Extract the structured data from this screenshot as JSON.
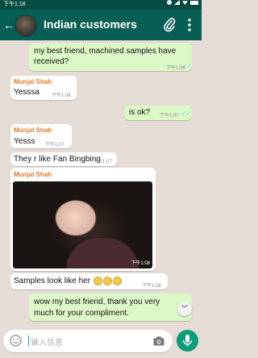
{
  "status_bar": {
    "time": "下午1:18"
  },
  "header": {
    "title": "Indian customers",
    "back_glyph": "←"
  },
  "messages": [
    {
      "type": "out",
      "text": "my best friend, machined samples have received?",
      "time": "下午1:06",
      "ticks": "✓✓"
    },
    {
      "type": "in",
      "sender": "Munjal Shah",
      "text": "Yesssa",
      "time": "下午1:06"
    },
    {
      "type": "out",
      "text": "is ok?",
      "time": "下午1:07",
      "ticks": "✓✓"
    },
    {
      "type": "in",
      "sender": "Munjal Shah",
      "text": "Yesss",
      "time": "下午1:07"
    },
    {
      "type": "in",
      "text": "They r like Fan Bingbing",
      "time": "下午1:07"
    },
    {
      "type": "in",
      "sender": "Munjal Shah",
      "image": true,
      "time": "下午1:08"
    },
    {
      "type": "in",
      "text": "Samples look like her",
      "time": "下午1:08"
    },
    {
      "type": "out",
      "text": "wow my best friend, thank you very much for your compliment."
    }
  ],
  "composer": {
    "placeholder": "输入信息"
  },
  "icons": {
    "back": "arrow-left-icon",
    "attach": "paperclip-icon",
    "more": "more-vert-icon",
    "emoji": "emoji-icon",
    "camera": "camera-icon",
    "mic": "mic-icon",
    "scroll": "chevron-down-icon"
  },
  "colors": {
    "statusbar": "#054d44",
    "appbar": "#075e54",
    "chat_bg": "#e5ddd5",
    "out_bubble": "#dcf8c6",
    "in_bubble": "#ffffff",
    "sender_name": "#e07a2c",
    "read_ticks": "#4fc3f7",
    "mic": "#0b9c7a"
  }
}
